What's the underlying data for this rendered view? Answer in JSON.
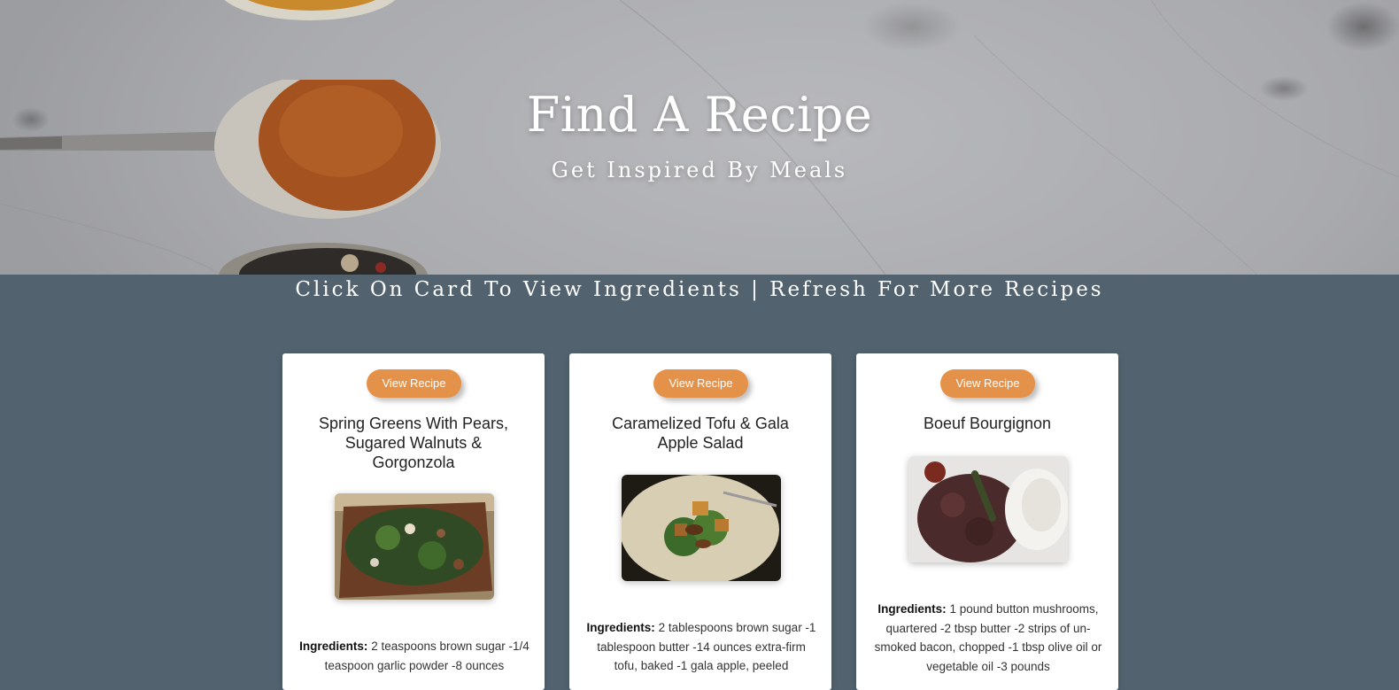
{
  "hero": {
    "title": "Find A Recipe",
    "subtitle": "Get Inspired By Meals"
  },
  "instructions": "Click On Card To View Ingredients | Refresh For More Recipes",
  "colors": {
    "accent": "#e4924a",
    "background": "#52636f",
    "card": "#ffffff"
  },
  "cards": [
    {
      "button_label": "View Recipe",
      "title": "Spring Greens With Pears, Sugared Walnuts & Gorgonzola",
      "image_alt": "salad with pears and walnuts in wooden bowl",
      "ingredients_label": "Ingredients:",
      "ingredients_text": "2 teaspoons brown sugar -1/4 teaspoon garlic powder -8 ounces"
    },
    {
      "button_label": "View Recipe",
      "title": "Caramelized Tofu & Gala Apple Salad",
      "image_alt": "tofu and apple salad on plate",
      "ingredients_label": "Ingredients:",
      "ingredients_text": "2 tablespoons brown sugar -1 tablespoon butter -14 ounces extra-firm tofu, baked -1 gala apple, peeled"
    },
    {
      "button_label": "View Recipe",
      "title": "Boeuf Bourgignon",
      "image_alt": "beef stew with rice",
      "ingredients_label": "Ingredients:",
      "ingredients_text": "1 pound button mushrooms, quartered -2 tbsp butter -2 strips of un-smoked bacon, chopped -1 tbsp olive oil or vegetable oil -3 pounds"
    }
  ]
}
